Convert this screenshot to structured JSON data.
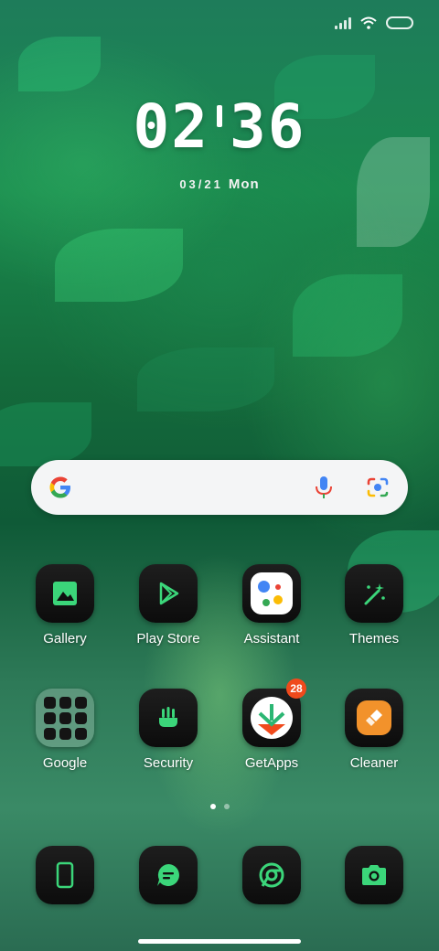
{
  "status_bar": {
    "icons": [
      "signal-icon",
      "wifi-icon",
      "battery-icon"
    ]
  },
  "clock": {
    "hours": "02",
    "minutes": "36",
    "date": "03/21",
    "day": "Mon"
  },
  "search_bar": {
    "icons": [
      "google-logo",
      "mic-icon",
      "lens-icon"
    ]
  },
  "home_apps": [
    {
      "label": "Gallery",
      "icon": "gallery-icon"
    },
    {
      "label": "Play Store",
      "icon": "play-store-icon"
    },
    {
      "label": "Assistant",
      "icon": "assistant-icon"
    },
    {
      "label": "Themes",
      "icon": "themes-icon"
    },
    {
      "label": "Google",
      "icon": "google-folder-icon"
    },
    {
      "label": "Security",
      "icon": "security-icon"
    },
    {
      "label": "GetApps",
      "icon": "getapps-icon",
      "badge": "28"
    },
    {
      "label": "Cleaner",
      "icon": "cleaner-icon"
    }
  ],
  "page_indicator": {
    "pages": 2,
    "current": 1
  },
  "dock": [
    {
      "icon": "phone-icon"
    },
    {
      "icon": "messages-icon"
    },
    {
      "icon": "chrome-icon"
    },
    {
      "icon": "camera-icon"
    }
  ],
  "colors": {
    "icon_green": "#3bd67a",
    "badge": "#f04a1c",
    "search_bg": "#f4f5f6"
  }
}
